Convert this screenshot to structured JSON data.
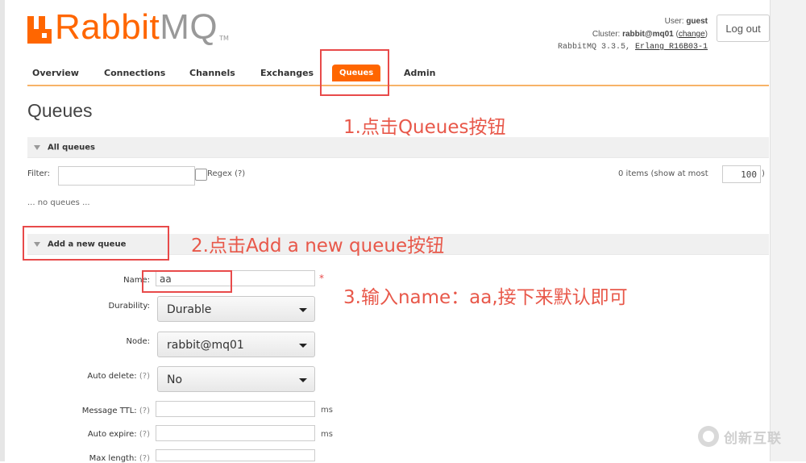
{
  "logo": {
    "rabbit": "Rabbit",
    "mq": "MQ",
    "tm": "TM"
  },
  "user": {
    "label": "User:",
    "name": "guest"
  },
  "cluster": {
    "label": "Cluster:",
    "name": "rabbit@mq01",
    "change": "change"
  },
  "version": {
    "text": "RabbitMQ 3.3.5,",
    "erlang": "Erlang R16B03-1"
  },
  "logout_label": "Log out",
  "tabs": [
    "Overview",
    "Connections",
    "Channels",
    "Exchanges",
    "Queues",
    "Admin"
  ],
  "page_title": "Queues",
  "annotations": [
    "1.点击Queues按钮",
    "2.点击Add a new queue按钮",
    "3.输入name：aa,接下来默认即可"
  ],
  "all_queues": {
    "title": "All queues",
    "filter_label": "Filter:",
    "filter_value": "",
    "regex_label": "Regex",
    "regex_help": "(?)",
    "items_label": "0 items (show at most",
    "items_value": "100",
    "items_close": ")",
    "empty_text": "... no queues ..."
  },
  "add_queue": {
    "title": "Add a new queue",
    "name_label": "Name:",
    "name_value": "aa",
    "required_mark": "*",
    "durability_label": "Durability:",
    "durability_value": "Durable",
    "node_label": "Node:",
    "node_value": "rabbit@mq01",
    "auto_delete_label": "Auto delete:",
    "auto_delete_value": "No",
    "message_ttl_label": "Message TTL:",
    "auto_expire_label": "Auto expire:",
    "max_length_label": "Max length:",
    "help": "(?)",
    "unit_ms": "ms"
  },
  "watermark": "创新互联",
  "colors": {
    "accent": "#ff6600",
    "annotation": "#e84a4a",
    "tab_underline": "#f7b368"
  }
}
